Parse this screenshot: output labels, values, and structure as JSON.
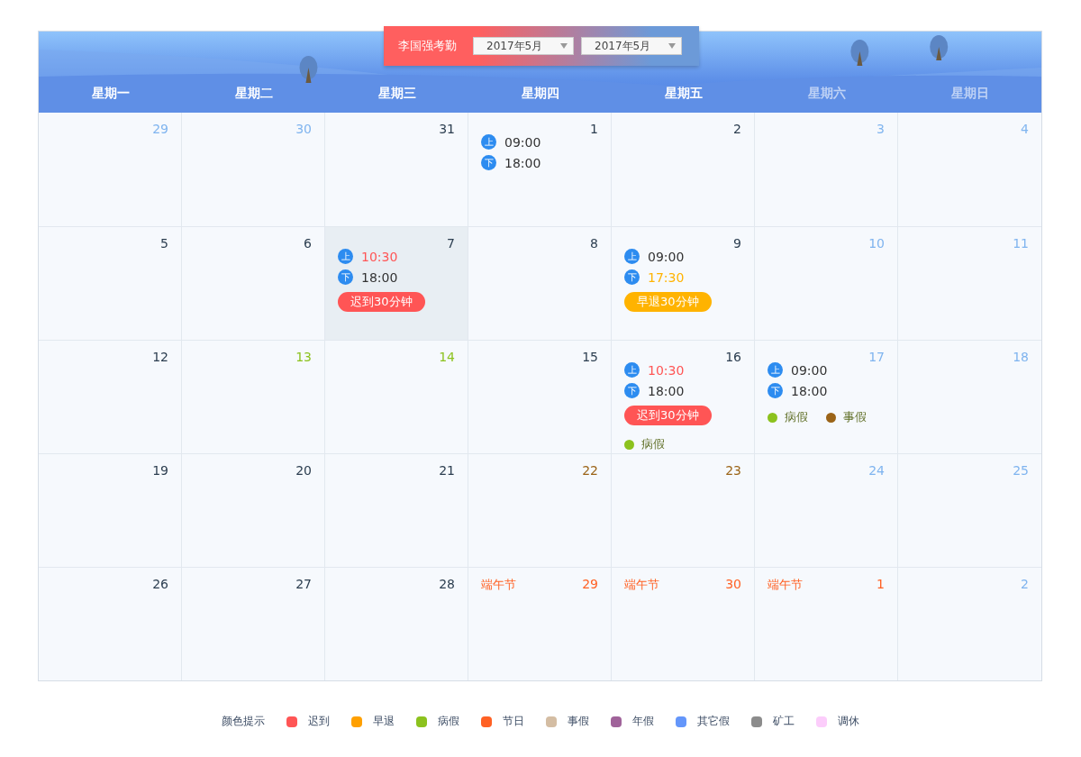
{
  "title_card": {
    "title": "李国强考勤",
    "selects": [
      {
        "value": "2017年5月"
      },
      {
        "value": "2017年5月"
      }
    ]
  },
  "weekdays": [
    {
      "label": "星期一",
      "weekend": false
    },
    {
      "label": "星期二",
      "weekend": false
    },
    {
      "label": "星期三",
      "weekend": false
    },
    {
      "label": "星期四",
      "weekend": false
    },
    {
      "label": "星期五",
      "weekend": false
    },
    {
      "label": "星期六",
      "weekend": true
    },
    {
      "label": "星期日",
      "weekend": true
    }
  ],
  "days": [
    {
      "day": "29",
      "kind": "muted",
      "selected": false
    },
    {
      "day": "30",
      "kind": "muted",
      "selected": false
    },
    {
      "day": "31",
      "kind": "normal",
      "selected": false
    },
    {
      "day": "1",
      "kind": "normal",
      "selected": false,
      "punches": [
        {
          "mark": "上",
          "time": "09:00",
          "kind": "normal"
        },
        {
          "mark": "下",
          "time": "18:00",
          "kind": "normal"
        }
      ]
    },
    {
      "day": "2",
      "kind": "normal",
      "selected": false
    },
    {
      "day": "3",
      "kind": "muted",
      "selected": false
    },
    {
      "day": "4",
      "kind": "muted",
      "selected": false
    },
    {
      "day": "5",
      "kind": "normal",
      "selected": false
    },
    {
      "day": "6",
      "kind": "normal",
      "selected": false
    },
    {
      "day": "7",
      "kind": "normal",
      "selected": true,
      "punches": [
        {
          "mark": "上",
          "time": "10:30",
          "kind": "late"
        },
        {
          "mark": "下",
          "time": "18:00",
          "kind": "normal"
        }
      ],
      "badge": {
        "text": "迟到30分钟",
        "kind": "late"
      }
    },
    {
      "day": "8",
      "kind": "normal",
      "selected": false
    },
    {
      "day": "9",
      "kind": "normal",
      "selected": false,
      "punches": [
        {
          "mark": "上",
          "time": "09:00",
          "kind": "normal"
        },
        {
          "mark": "下",
          "time": "17:30",
          "kind": "early"
        }
      ],
      "badge": {
        "text": "早退30分钟",
        "kind": "early"
      }
    },
    {
      "day": "10",
      "kind": "muted",
      "selected": false
    },
    {
      "day": "11",
      "kind": "muted",
      "selected": false
    },
    {
      "day": "12",
      "kind": "normal",
      "selected": false
    },
    {
      "day": "13",
      "kind": "sick",
      "selected": false
    },
    {
      "day": "14",
      "kind": "sick",
      "selected": false
    },
    {
      "day": "15",
      "kind": "normal",
      "selected": false
    },
    {
      "day": "16",
      "kind": "normal",
      "selected": false,
      "punches": [
        {
          "mark": "上",
          "time": "10:30",
          "kind": "late"
        },
        {
          "mark": "下",
          "time": "18:00",
          "kind": "normal"
        }
      ],
      "badge": {
        "text": "迟到30分钟",
        "kind": "late"
      },
      "leaves": [
        {
          "label": "病假",
          "color": "#8cc21e"
        }
      ]
    },
    {
      "day": "17",
      "kind": "muted",
      "selected": false,
      "punches": [
        {
          "mark": "上",
          "time": "09:00",
          "kind": "normal"
        },
        {
          "mark": "下",
          "time": "18:00",
          "kind": "normal"
        }
      ],
      "leaves": [
        {
          "label": "病假",
          "color": "#8cc21e"
        },
        {
          "label": "事假",
          "color": "#9b6418"
        }
      ]
    },
    {
      "day": "18",
      "kind": "muted",
      "selected": false
    },
    {
      "day": "19",
      "kind": "normal",
      "selected": false
    },
    {
      "day": "20",
      "kind": "normal",
      "selected": false
    },
    {
      "day": "21",
      "kind": "normal",
      "selected": false
    },
    {
      "day": "22",
      "kind": "personal",
      "selected": false
    },
    {
      "day": "23",
      "kind": "personal",
      "selected": false
    },
    {
      "day": "24",
      "kind": "muted",
      "selected": false
    },
    {
      "day": "25",
      "kind": "muted",
      "selected": false
    },
    {
      "day": "26",
      "kind": "normal",
      "selected": false
    },
    {
      "day": "27",
      "kind": "normal",
      "selected": false
    },
    {
      "day": "28",
      "kind": "normal",
      "selected": false
    },
    {
      "day": "29",
      "kind": "holiday",
      "selected": false,
      "holiday": "端午节"
    },
    {
      "day": "30",
      "kind": "holiday",
      "selected": false,
      "holiday": "端午节"
    },
    {
      "day": "1",
      "kind": "holiday",
      "selected": false,
      "holiday": "端午节"
    },
    {
      "day": "2",
      "kind": "muted",
      "selected": false
    }
  ],
  "legend": {
    "title": "颜色提示",
    "items": [
      {
        "label": "迟到",
        "color": "#ff5555"
      },
      {
        "label": "早退",
        "color": "#ffa000"
      },
      {
        "label": "病假",
        "color": "#8cc21e"
      },
      {
        "label": "节日",
        "color": "#ff6124"
      },
      {
        "label": "事假",
        "color": "#d4bda3"
      },
      {
        "label": "年假",
        "color": "#a0639a"
      },
      {
        "label": "其它假",
        "color": "#6496fa"
      },
      {
        "label": "矿工",
        "color": "#8c8c8c"
      },
      {
        "label": "调休",
        "color": "#fccdfb"
      }
    ]
  }
}
